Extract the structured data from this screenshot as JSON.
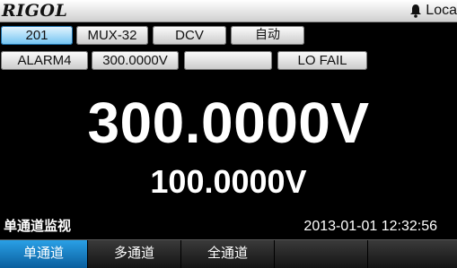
{
  "topbar": {
    "brand": "RIGOL",
    "status_text": "Loca",
    "status_icon": "bell-icon"
  },
  "row1": {
    "channel": "201",
    "card": "MUX-32",
    "function": "DCV",
    "range": "自动"
  },
  "row2": {
    "alarm": "ALARM4",
    "limit_value": "300.0000V",
    "empty_field": "",
    "limit_status": "LO FAIL"
  },
  "display": {
    "main_reading": "300.0000V",
    "secondary_reading": "100.0000V"
  },
  "status": {
    "mode": "单通道监视",
    "datetime": "2013-01-01 12:32:56"
  },
  "softkeys": [
    {
      "label": "单通道"
    },
    {
      "label": "多通道"
    },
    {
      "label": "全通道"
    },
    {
      "label": ""
    },
    {
      "label": ""
    }
  ],
  "colors": {
    "background": "#000000",
    "selected": "#4fb3ee",
    "active_softkey": "#1583cc"
  }
}
